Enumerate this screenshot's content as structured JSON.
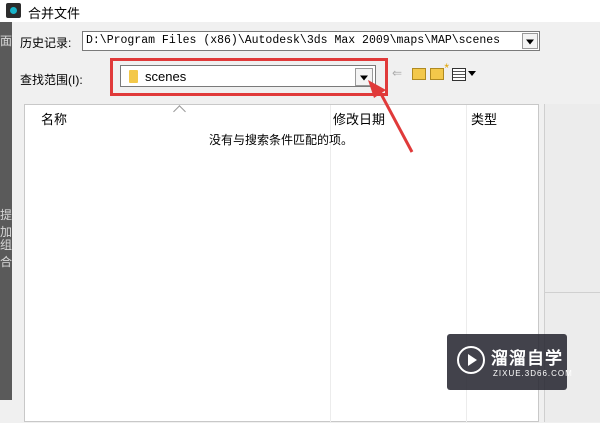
{
  "window": {
    "title": "合并文件",
    "icon": "app-3dsmax-icon"
  },
  "background_app": {
    "fragments": [
      "面",
      "提加",
      "组合"
    ]
  },
  "history": {
    "label": "历史记录:",
    "value": "D:\\Program Files (x86)\\Autodesk\\3ds Max 2009\\maps\\MAP\\scenes"
  },
  "lookin": {
    "label": "查找范围(I):",
    "value": "scenes"
  },
  "toolbar_icons": [
    "back-icon",
    "up-folder-icon",
    "new-folder-icon",
    "view-menu-icon"
  ],
  "file_list": {
    "columns": [
      "名称",
      "修改日期",
      "类型"
    ],
    "empty_message": "没有与搜索条件匹配的项。"
  },
  "annotation": {
    "color": "#e03a3a"
  },
  "watermark": {
    "title": "溜溜自学",
    "subtitle": "ZIXUE.3D66.COM"
  }
}
